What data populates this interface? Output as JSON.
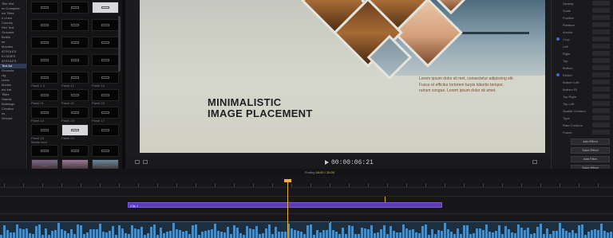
{
  "sidebar": {
    "items": [
      "Title Hist",
      "en Complete",
      "ew Titles",
      "n Lines",
      "Country",
      "",
      "Rex Text",
      "Grounds",
      "Builds",
      "ee",
      "Moodes",
      "ATROLES",
      "ELODIES",
      "ATROLES",
      "Text Ad",
      "Grounds",
      "ctg",
      "Lines",
      "Modes",
      "ext Intr",
      "Titles",
      "Stands",
      "Buildings",
      "Creation",
      "ns",
      "Ground"
    ],
    "active_index": 14
  },
  "browser": {
    "thumb_labels": [
      "Panel 1 4",
      "Panel 12",
      "Panel 16",
      "Panel 21",
      "Panel 22",
      "Panel 23",
      "Panel 14",
      "Panel 19",
      "Panel 17",
      "Panel 18",
      "Panel 24"
    ],
    "section_label": "Media Intro",
    "bottom_labels": [
      "Editorial 1",
      "Trailer 1",
      "Trailer 2"
    ]
  },
  "canvas": {
    "headline": "MINIMALISTIC\nIMAGE PLACEMENT",
    "lorem": "Lorem ipsum dolor sit met, consectetur adipiscing elit. Fusce et efficitur tortorem turpis lobortis tempor, rutrum congue. Lorem ipsum dolor sit amet."
  },
  "viewer": {
    "timecode": "00:00:06:21"
  },
  "inspector": {
    "rows": [
      "Opacity",
      "Scale",
      "Position",
      "Rotation",
      "Anchor",
      "Crop",
      "Left",
      "Right",
      "Top",
      "Bottom",
      "Distort",
      "Bottom Left",
      "Bottom Rt",
      "Top Right",
      "Top Left",
      "Spatial Conform",
      "Type",
      "Rate Conform",
      "Frame"
    ],
    "buttons": [
      "Add Effect",
      "Save Effect",
      "Add Filter",
      "Save Effect",
      "Save Preset"
    ]
  },
  "timeline": {
    "project_label": "Ending",
    "selection_label": "04:00 / 10:00",
    "clip_label": "Clip 1"
  },
  "colors": {
    "accent": "#e9b23a",
    "clip": "#5c3bb0",
    "audio": "#1d2f3f"
  }
}
